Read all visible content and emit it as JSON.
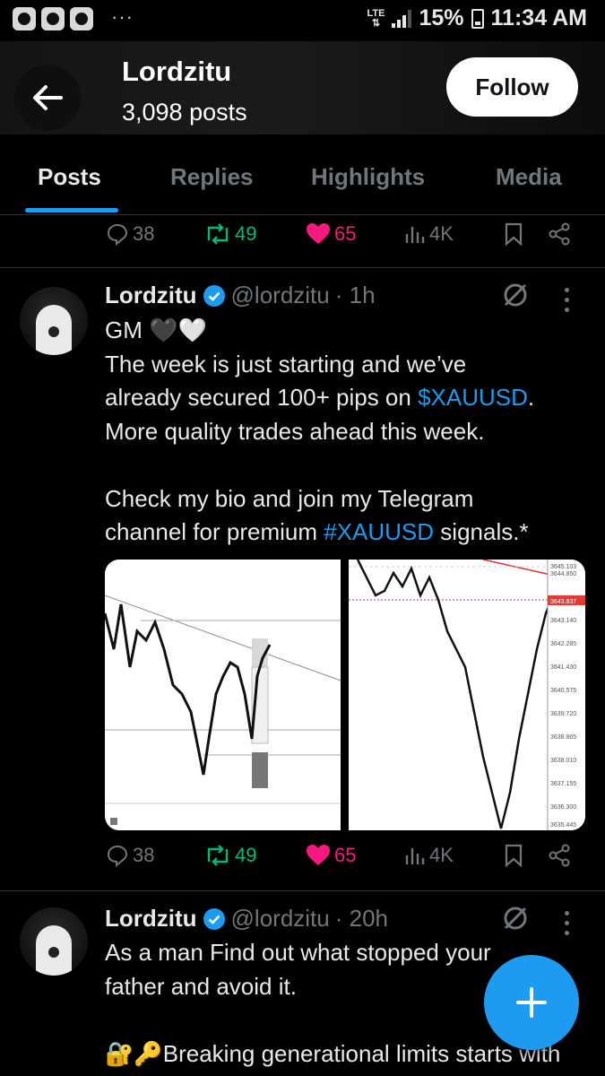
{
  "status_bar": {
    "dots": "···",
    "network": "LTE",
    "battery": "15%",
    "time": "11:34 AM"
  },
  "header": {
    "name": "Lordzitu",
    "posts_count": "3,098 posts",
    "follow_label": "Follow"
  },
  "tabs": [
    "Posts",
    "Replies",
    "Highlights",
    "Media"
  ],
  "active_tab": "Posts",
  "top_actions": {
    "replies": "38",
    "reposts": "49",
    "likes": "65",
    "views": "4K"
  },
  "tweets": [
    {
      "name": "Lordzitu",
      "handle": "@lordzitu",
      "time": "· 1h",
      "lines": [
        {
          "text": "GM 🖤🤍"
        },
        {
          "text": "The week is just starting and we’ve"
        },
        {
          "pre": "already secured 100+ pips on ",
          "link": "$XAUUSD",
          "post": "."
        },
        {
          "text": "More quality trades ahead this week."
        },
        {
          "text": ""
        },
        {
          "text": "Check my bio and join my Telegram"
        },
        {
          "pre": "channel for premium ",
          "link": "#XAUUSD",
          "post": " signals.*"
        }
      ],
      "actions": {
        "replies": "38",
        "reposts": "49",
        "likes": "65",
        "views": "4K"
      },
      "chart_right_labels": [
        "3645.103",
        "3644.850",
        "3643.837",
        "3643.140",
        "3642.285",
        "3641.430",
        "3640.575",
        "3639.720",
        "3638.865",
        "3638.010",
        "3637.155",
        "3636.300",
        "3635.445"
      ]
    },
    {
      "name": "Lordzitu",
      "handle": "@lordzitu",
      "time": "· 20h",
      "lines": [
        {
          "text": "As a man Find out what stopped your"
        },
        {
          "text": "father and avoid it."
        },
        {
          "text": ""
        },
        {
          "text": "🔐🔑Breaking generational limits starts with"
        }
      ]
    }
  ],
  "colors": {
    "accent": "#1d9bf0",
    "repost": "#00ba7c",
    "like": "#f91880",
    "muted": "#71767b",
    "background": "#000000"
  }
}
